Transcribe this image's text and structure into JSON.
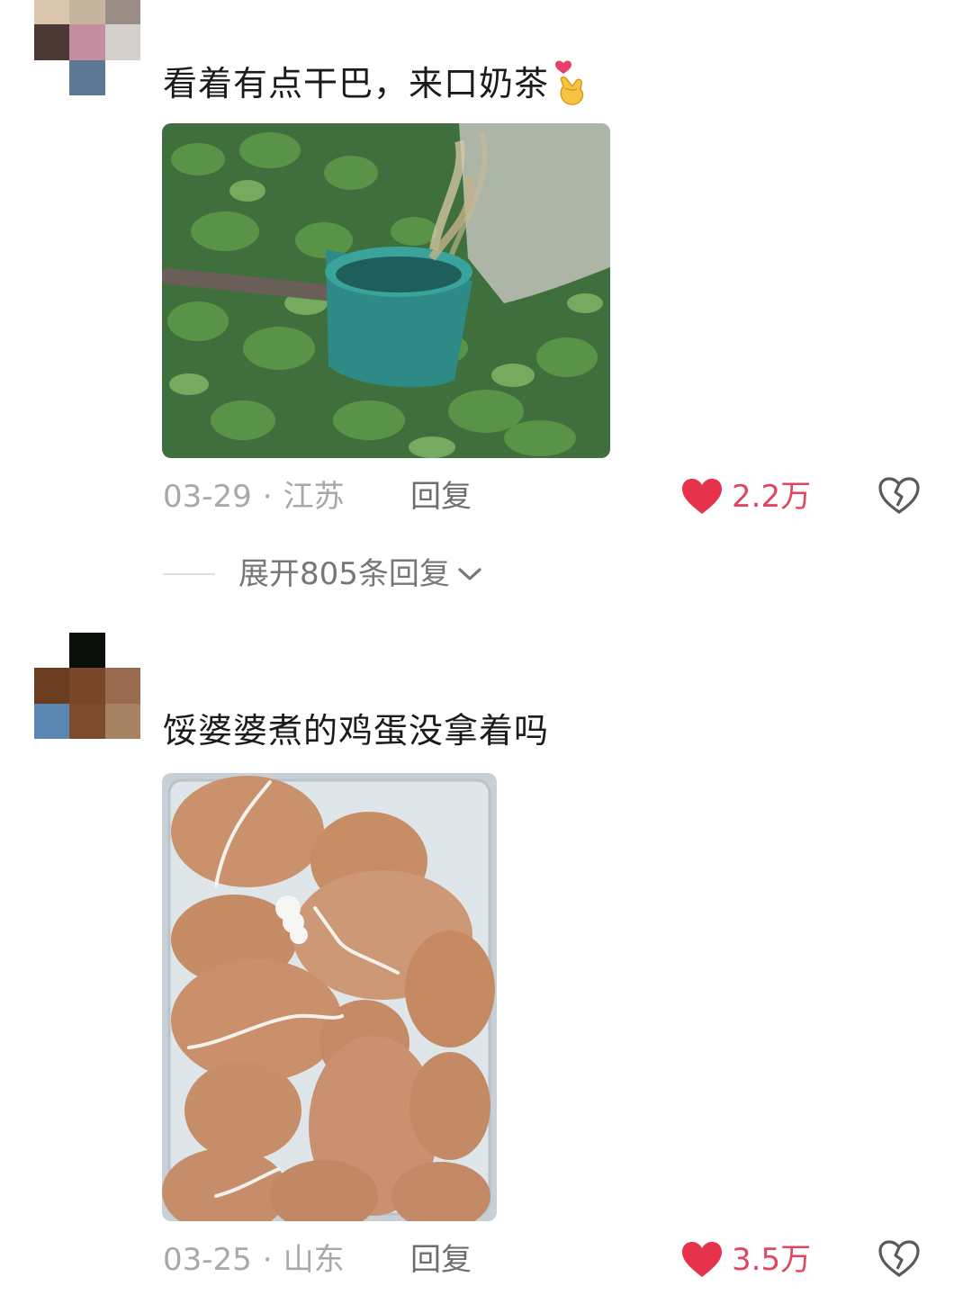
{
  "comments": [
    {
      "text": "看着有点干巴，来口奶茶",
      "emoji": "finger-heart",
      "date": "03-29",
      "location": "江苏",
      "reply_label": "回复",
      "likes": "2.2万",
      "expand_replies": "展开805条回复",
      "photo_subject": "watering-crop-field"
    },
    {
      "text": "馁婆婆煮的鸡蛋没拿着吗",
      "date": "03-25",
      "location": "山东",
      "reply_label": "回复",
      "likes": "3.5万",
      "photo_subject": "boiled-eggs-in-box"
    }
  ],
  "separator": "·",
  "colors": {
    "like_red": "#e6324b",
    "like_count": "#e34561",
    "meta_gray": "#a8a8a8",
    "reply_gray": "#6e6e6e"
  }
}
